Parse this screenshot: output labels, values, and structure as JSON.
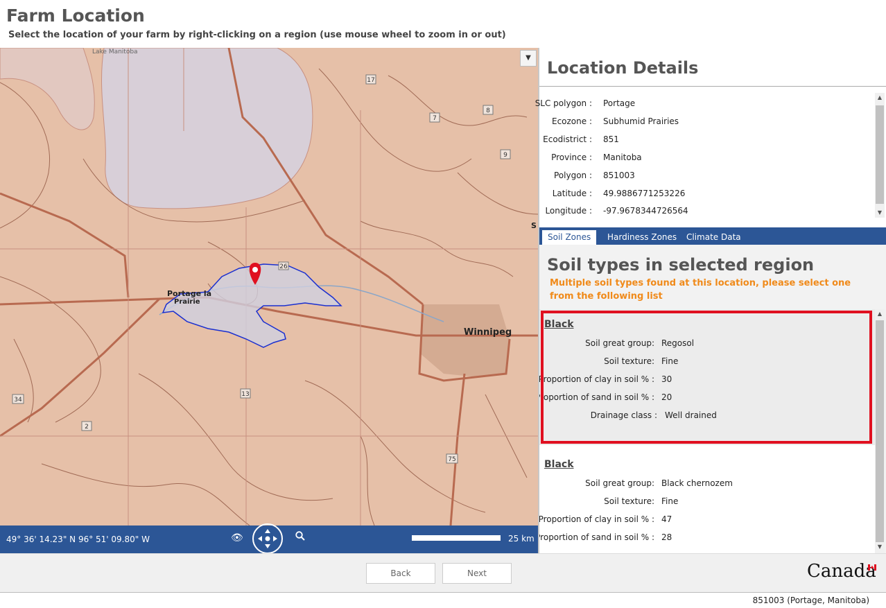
{
  "header": {
    "title": "Farm Location",
    "subtitle": "Select the location of your farm by right-clicking on a region (use mouse wheel to zoom in or out)"
  },
  "map": {
    "labels": {
      "lake": "Lake Manitoba",
      "city1_line1": "Portage la",
      "city1_line2": "Prairie",
      "city2": "Winnipeg"
    },
    "route_numbers": [
      "17",
      "8",
      "7",
      "9",
      "26",
      "13",
      "34",
      "2",
      "75",
      "S"
    ],
    "coordinates": "49° 36' 14.23\" N 96° 51' 09.80\" W",
    "scale_text": "25 km",
    "icons": {
      "visibility": "eye-icon",
      "pan": "pan-control-icon",
      "zoom": "magnifier-icon",
      "marker": "map-pin-icon",
      "dropdown": "chevron-down-icon"
    }
  },
  "location_details": {
    "title": "Location Details",
    "rows": [
      {
        "label": "SLC polygon :",
        "value": "Portage"
      },
      {
        "label": "Ecozone :",
        "value": "Subhumid Prairies"
      },
      {
        "label": "Ecodistrict :",
        "value": "851"
      },
      {
        "label": "Province :",
        "value": "Manitoba"
      },
      {
        "label": "Polygon :",
        "value": "851003"
      },
      {
        "label": "Latitude :",
        "value": "49.9886771253226"
      },
      {
        "label": "Longitude :",
        "value": "-97.9678344726564"
      }
    ]
  },
  "tabs": [
    {
      "label": "Soil Zones",
      "active": true
    },
    {
      "label": "Hardiness Zones",
      "active": false
    },
    {
      "label": "Climate Data",
      "active": false
    }
  ],
  "soil": {
    "title": "Soil types in selected region",
    "warning": "Multiple soil types found at this location, please select one from the following list",
    "warning_color": "#f08a1a",
    "highlight_color": "#e01020",
    "items": [
      {
        "name": "Black",
        "rows": [
          {
            "label": "Soil great group:",
            "value": "Regosol"
          },
          {
            "label": "Soil texture:",
            "value": "Fine"
          },
          {
            "label": "Proportion of clay in soil % :",
            "value": "30"
          },
          {
            "label": "Proportion of sand in soil % :",
            "value": "20"
          },
          {
            "label": "Drainage class :",
            "value": "Well drained"
          }
        ]
      },
      {
        "name": "Black",
        "rows": [
          {
            "label": "Soil great group:",
            "value": "Black chernozem"
          },
          {
            "label": "Soil texture:",
            "value": "Fine"
          },
          {
            "label": "Proportion of clay in soil % :",
            "value": "47"
          },
          {
            "label": "Proportion of sand in soil % :",
            "value": "28"
          }
        ]
      }
    ]
  },
  "footer": {
    "back_label": "Back",
    "next_label": "Next",
    "logo_text": "Canada",
    "status": "851003 (Portage, Manitoba)"
  },
  "colors": {
    "accent": "#2c5696",
    "map_land": "#e6c0a8",
    "map_lake": "#d8cfd8"
  }
}
